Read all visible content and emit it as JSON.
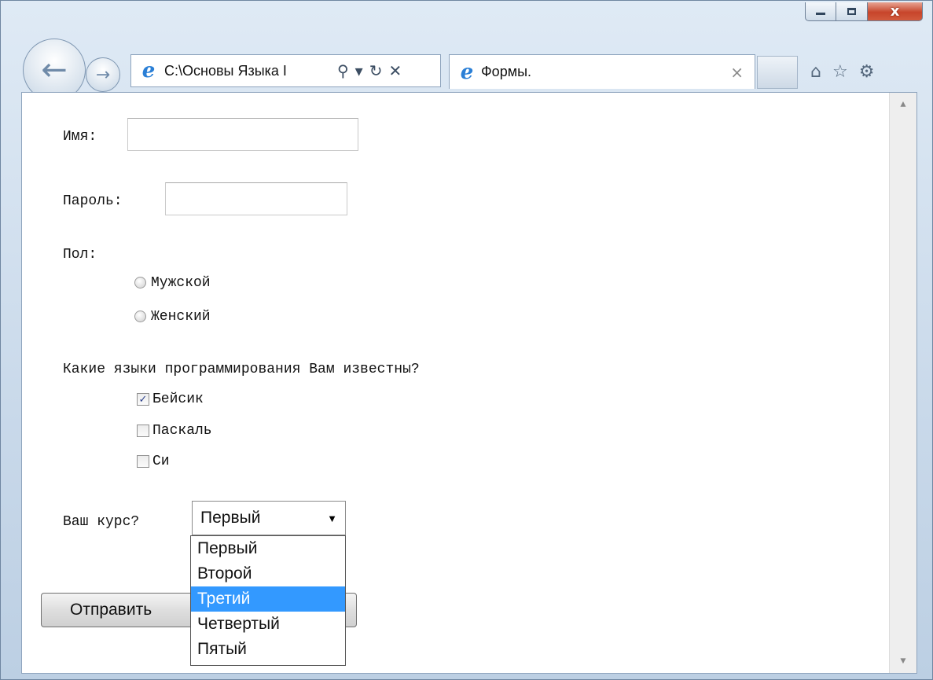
{
  "browser": {
    "address": "C:\\Основы Языка I",
    "tab_title": "Формы.",
    "tab_close": "×",
    "addr_tools": {
      "search": "⚲",
      "dropdown": "▾",
      "refresh": "↻",
      "stop": "✕"
    },
    "window_controls": {
      "close": "x"
    },
    "nav": {
      "back": "←",
      "forward": "→"
    },
    "cmd_icons": {
      "home": "⌂",
      "favorites": "☆",
      "tools": "⚙"
    }
  },
  "form": {
    "name_label": "Имя:",
    "password_label": "Пароль:",
    "gender_label": "Пол:",
    "gender_options": [
      "Мужской",
      "Женский"
    ],
    "languages_label": "Какие языки программирования Вам известны?",
    "languages": [
      {
        "label": "Бейсик",
        "checked": true
      },
      {
        "label": "Паскаль",
        "checked": false
      },
      {
        "label": "Си",
        "checked": false
      }
    ],
    "course_label": "Ваш курс?",
    "course_selected": "Первый",
    "course_options": [
      "Первый",
      "Второй",
      "Третий",
      "Четвертый",
      "Пятый"
    ],
    "course_highlighted": "Третий",
    "submit_label": "Отправить",
    "check_mark": "✓"
  }
}
